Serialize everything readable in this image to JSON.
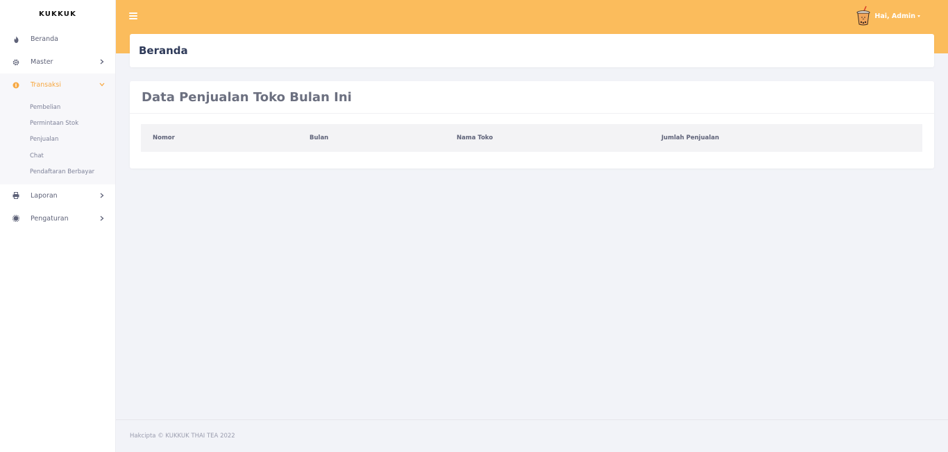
{
  "sidebar": {
    "brand": "KUKKUK",
    "items": [
      {
        "label": "Beranda",
        "icon": "fire-icon"
      },
      {
        "label": "Master",
        "icon": "gear-icon"
      },
      {
        "label": "Transaksi",
        "icon": "coin-icon"
      },
      {
        "label": "Laporan",
        "icon": "printer-icon"
      },
      {
        "label": "Pengaturan",
        "icon": "cog-icon"
      }
    ],
    "submenu": [
      "Pembelian",
      "Permintaan Stok",
      "Penjualan",
      "Chat",
      "Pendaftaran Berbayar"
    ]
  },
  "topbar": {
    "greeting": "Hai, Admin",
    "bg_color": "#fbbc5c"
  },
  "page": {
    "title": "Beranda"
  },
  "card": {
    "title": "Data Penjualan Toko Bulan Ini",
    "columns": [
      "Nomor",
      "Bulan",
      "Nama Toko",
      "Jumlah Penjualan"
    ]
  },
  "footer": {
    "text": "Hakcipta © KUKKUK THAI TEA 2022"
  },
  "colors": {
    "accent": "#f7a944",
    "background": "#f2f3f8"
  }
}
